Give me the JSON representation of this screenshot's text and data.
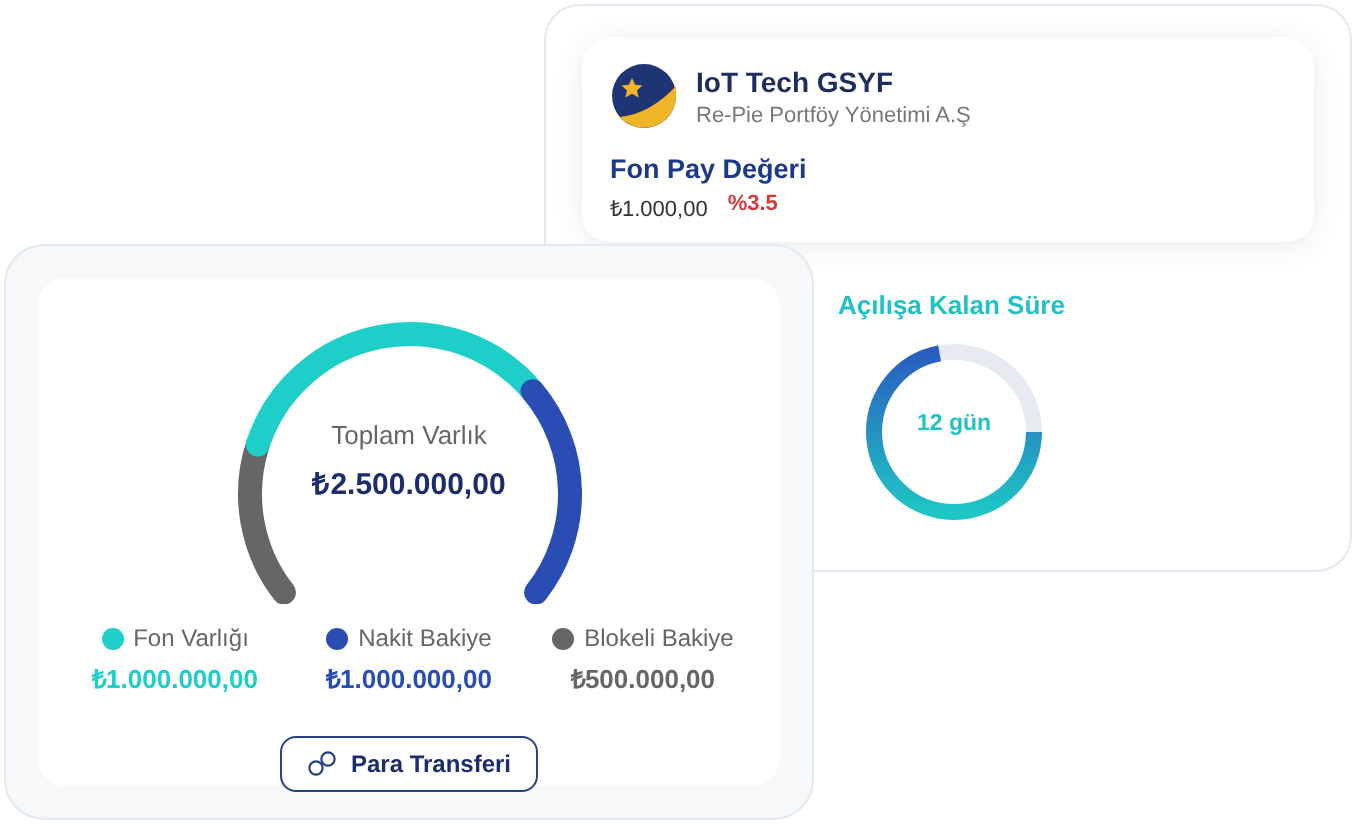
{
  "fund_card": {
    "name": "IoT Tech GSYF",
    "company": "Re-Pie Portföy Yönetimi A.Ş",
    "price_title": "Fon Pay Değeri",
    "price": "₺1.000,00",
    "change": "%3.5"
  },
  "countdown": {
    "title": "Açılışa Kalan Süre",
    "label": "12 gün",
    "level": 0.72
  },
  "assets": {
    "title": "Toplam Varlık",
    "total": "₺2.500.000,00",
    "legend": [
      {
        "label": "Fon Varlığı",
        "amount": "₺1.000.000,00",
        "color": "#1ecfc9"
      },
      {
        "label": "Nakit Bakiye",
        "amount": "₺1.000.000,00",
        "color": "#2a4db3"
      },
      {
        "label": "Blokeli Bakiye",
        "amount": "₺500.000,00",
        "color": "#666666"
      }
    ],
    "button": "Para Transferi"
  }
}
